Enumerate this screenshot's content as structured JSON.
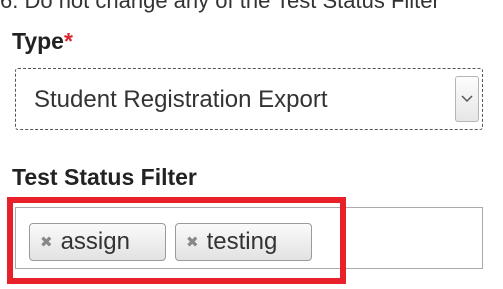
{
  "caption": "6.   Do not change any of the Test Status Filter",
  "type_field": {
    "label": "Type",
    "required_marker": "*",
    "selected_value": "Student Registration Export",
    "dropdown_icon": "chevron-down-icon"
  },
  "filter_field": {
    "label": "Test Status Filter",
    "tags": [
      {
        "label": "assign",
        "remove_icon": "close-icon"
      },
      {
        "label": "testing",
        "remove_icon": "close-icon"
      }
    ]
  },
  "colors": {
    "highlight": "#e8202a",
    "required": "#d9262e"
  }
}
